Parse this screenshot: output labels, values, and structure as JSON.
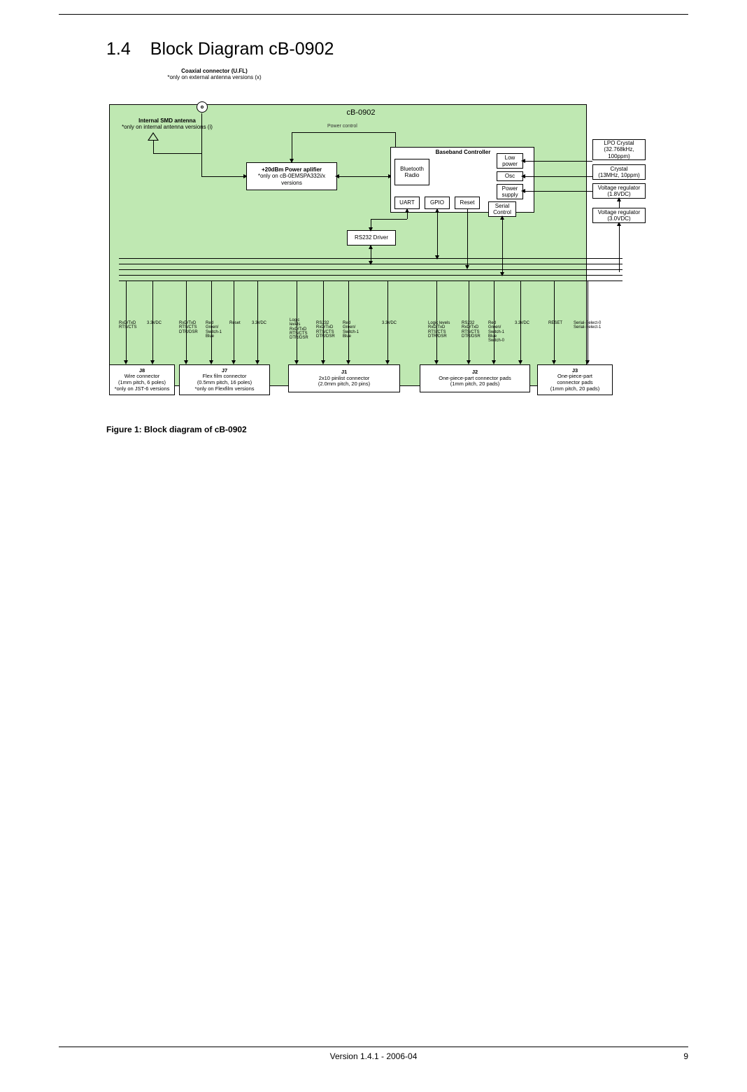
{
  "section": {
    "number": "1.4",
    "title": "Block Diagram cB-0902"
  },
  "coax": {
    "title": "Coaxial connector (U.FL)",
    "note": "*only on external antenna versions (x)"
  },
  "board_title": "cB-0902",
  "smd": {
    "title": "Internal SMD antenna",
    "note": "*only on internal antenna versions (i)"
  },
  "power_control": "Power control",
  "amp": {
    "title": "+20dBm Power aplifier",
    "note1": "*only on cB-0EMSPA332i/x",
    "note2": "versions"
  },
  "baseband_title": "Baseband Controller",
  "bt_radio": "Bluetooth\nRadio",
  "uart": "UART",
  "gpio": "GPIO",
  "reset": "Reset",
  "lowpower": "Low\npower",
  "osc": "Osc",
  "psupply": "Power\nsupply",
  "serialctrl": "Serial\nControl",
  "rs232": "RS232 Driver",
  "ext": {
    "lpo": "LPO Crystal\n(32.768kHz,\n100ppm)",
    "crystal": "Crystal\n(13MHz, 10ppm)",
    "v18": "Voltage regulator\n(1.8VDC)",
    "v30": "Voltage regulator\n(3.0VDC)"
  },
  "sigs": {
    "j8a": "RxD/TxD\nRTS/CTS",
    "j8b": "3.3VDC",
    "j7a": "RxD/TxD\nRTS/CTS\nDTR/DSR",
    "j7b": "Red\nGreen/\nSwitch-1\nBlue",
    "j7c": "Reset",
    "j7d": "3.3VDC",
    "j1a": "Logic\nlevels\nRxD/TxD\nRTS/CTS\nDTR/DSR",
    "j1b": "RS232\nRxD/TxD\nRTS/CTS\nDTR/DSR",
    "j1c": "Red\nGreen/\nSwitch-1\nBlue",
    "j1d": "3.3VDC",
    "j2a": "Logic levels\nRxD/TxD\nRTS/CTS\nDTR/DSR",
    "j2b": "RS232\nRxD/TxD\nRTS/CTS\nDTR/DSR",
    "j2c": "Red\nGreen/\nSwitch-1\nBlue\nSwitch-0",
    "j2d": "3.3VDC",
    "j3a": "RESET",
    "j3b": "Serial-Select-0\nSerial-Select-1"
  },
  "conn": {
    "j8": {
      "name": "J8",
      "l1": "Wire connector",
      "l2": "(1mm pitch, 6 poles)",
      "l3": "*only on JST-6 versions"
    },
    "j7": {
      "name": "J7",
      "l1": "Flex film connector",
      "l2": "(0.5mm pitch, 16 poles)",
      "l3": "*only on Flexfilm versions"
    },
    "j1": {
      "name": "J1",
      "l1": "2x10 pinlist connector",
      "l2": "(2.0mm pitch, 20 pins)",
      "l3": ""
    },
    "j2": {
      "name": "J2",
      "l1": "One-piece-part connector pads",
      "l2": "(1mm pitch, 20 pads)",
      "l3": ""
    },
    "j3": {
      "name": "J3",
      "l1": "One-piece-part",
      "l2": "connector pads",
      "l3": "(1mm pitch, 20 pads)"
    }
  },
  "caption": "Figure 1:  Block diagram of cB-0902",
  "footer": {
    "center": "Version 1.4.1 - 2006-04",
    "right": "9"
  }
}
